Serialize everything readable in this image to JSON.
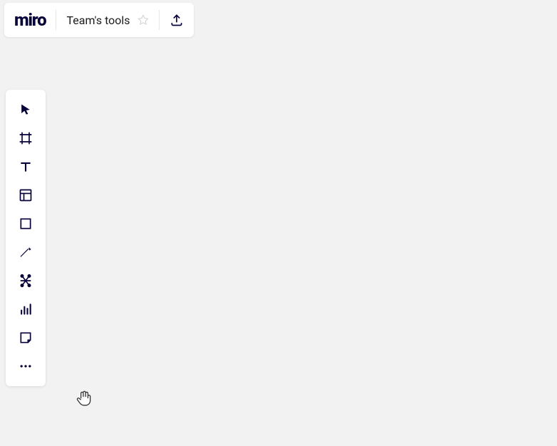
{
  "header": {
    "logo_text": "miro",
    "board_title": "Team's tools"
  },
  "toolbar": {
    "tools": [
      {
        "name": "select",
        "icon": "cursor"
      },
      {
        "name": "frame",
        "icon": "frame"
      },
      {
        "name": "text",
        "icon": "text"
      },
      {
        "name": "templates",
        "icon": "template"
      },
      {
        "name": "rectangle",
        "icon": "square"
      },
      {
        "name": "line",
        "icon": "arrow"
      },
      {
        "name": "diagram",
        "icon": "diagram"
      },
      {
        "name": "chart",
        "icon": "chart"
      },
      {
        "name": "sticky",
        "icon": "sticky"
      },
      {
        "name": "more",
        "icon": "dots"
      }
    ]
  },
  "cursor": {
    "type": "hand",
    "state": "hover"
  }
}
